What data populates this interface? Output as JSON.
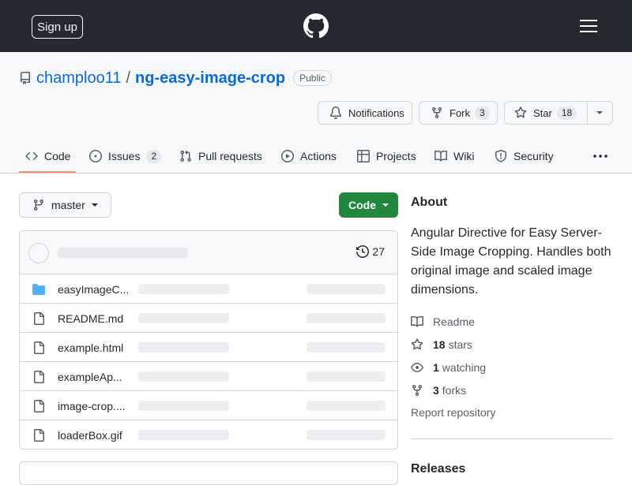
{
  "header": {
    "signup_label": "Sign up",
    "logo_icon": "github-mark-icon",
    "menu_icon": "hamburger-icon"
  },
  "repo": {
    "owner": "champloo11",
    "separator": "/",
    "name": "ng-easy-image-crop",
    "visibility": "Public",
    "notifications_label": "Notifications",
    "fork_label": "Fork",
    "fork_count": "3",
    "star_label": "Star",
    "star_count": "18"
  },
  "tabs": [
    {
      "label": "Code",
      "icon": "code-icon",
      "active": true
    },
    {
      "label": "Issues",
      "icon": "issue-icon",
      "count": "2"
    },
    {
      "label": "Pull requests",
      "icon": "pull-request-icon"
    },
    {
      "label": "Actions",
      "icon": "play-icon"
    },
    {
      "label": "Projects",
      "icon": "table-icon"
    },
    {
      "label": "Wiki",
      "icon": "book-icon"
    },
    {
      "label": "Security",
      "icon": "shield-icon"
    }
  ],
  "main": {
    "branch": "master",
    "code_button": "Code",
    "commit_count": "27",
    "files": [
      {
        "name": "easyImageC...",
        "type": "folder"
      },
      {
        "name": "README.md",
        "type": "file"
      },
      {
        "name": "example.html",
        "type": "file"
      },
      {
        "name": "exampleAp...",
        "type": "file"
      },
      {
        "name": "image-crop....",
        "type": "file"
      },
      {
        "name": "loaderBox.gif",
        "type": "file"
      }
    ]
  },
  "about": {
    "title": "About",
    "description": "Angular Directive for Easy Server-Side Image Cropping. Handles both original image and scaled image dimensions.",
    "readme": "Readme",
    "stars_count": "18",
    "stars_label": "stars",
    "watching_count": "1",
    "watching_label": "watching",
    "forks_count": "3",
    "forks_label": "forks",
    "report": "Report repository",
    "releases_title": "Releases"
  },
  "colors": {
    "header_bg": "#24292f",
    "link": "#0969da",
    "code_button": "#1f883d",
    "active_tab_underline": "#fd8c73",
    "folder_icon": "#54aeff"
  }
}
